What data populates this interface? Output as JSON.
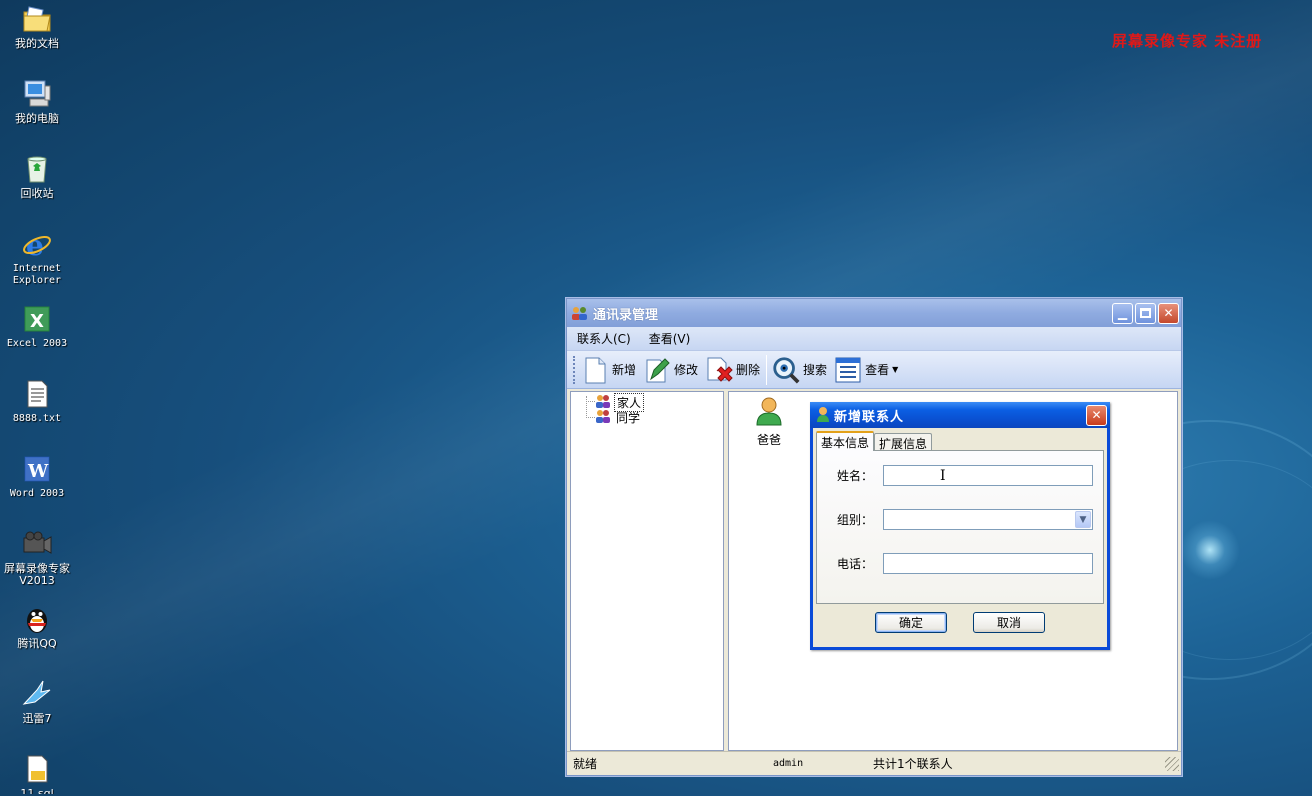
{
  "watermark": "屏幕录像专家 未注册",
  "desktop": {
    "icons": [
      {
        "label": "我的文档",
        "icon": "my-documents-icon"
      },
      {
        "label": "我的电脑",
        "icon": "my-computer-icon"
      },
      {
        "label": "回收站",
        "icon": "recycle-bin-icon"
      },
      {
        "label": "Internet\nExplorer",
        "icon": "internet-explorer-icon"
      },
      {
        "label": "Excel 2003",
        "icon": "excel-icon"
      },
      {
        "label": "8888.txt",
        "icon": "text-file-icon"
      },
      {
        "label": "Word 2003",
        "icon": "word-icon"
      },
      {
        "label": "屏幕录像专家V2013",
        "icon": "screen-recorder-icon"
      },
      {
        "label": "腾讯QQ",
        "icon": "qq-icon"
      },
      {
        "label": "迅雷7",
        "icon": "thunder-icon"
      },
      {
        "label": "11.sql",
        "icon": "sql-file-icon"
      }
    ]
  },
  "main_window": {
    "title": "通讯录管理",
    "menu": [
      "联系人(C)",
      "查看(V)"
    ],
    "toolbar": [
      {
        "label": "新增",
        "icon": "new-document-icon"
      },
      {
        "label": "修改",
        "icon": "edit-pencil-icon"
      },
      {
        "label": "删除",
        "icon": "delete-x-icon"
      },
      {
        "label": "搜索",
        "icon": "search-magnifier-icon"
      },
      {
        "label": "查看",
        "icon": "view-list-icon"
      }
    ],
    "tree": [
      "家人",
      "同学"
    ],
    "contacts": [
      {
        "label": "爸爸",
        "icon": "person-icon"
      }
    ],
    "status": {
      "left": "就绪",
      "user": "admin",
      "count": "共计1个联系人"
    }
  },
  "dialog": {
    "title": "新增联系人",
    "tabs": [
      "基本信息",
      "扩展信息"
    ],
    "fields": {
      "name_label": "姓名：",
      "group_label": "组别：",
      "phone_label": "电话："
    },
    "ok": "确定",
    "cancel": "取消"
  },
  "colors": {
    "watermark": "#e01818",
    "dialog_border": "#0a4bd8"
  }
}
